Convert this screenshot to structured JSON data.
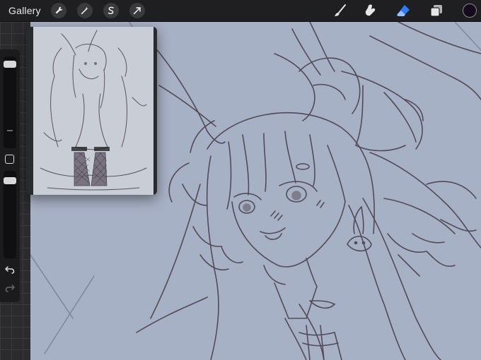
{
  "toolbar": {
    "gallery_label": "Gallery",
    "left_tools": [
      "actions-wrench",
      "adjustments-magic-wand",
      "selection-s",
      "transform-arrow"
    ],
    "right_tools": [
      "brush",
      "smudge",
      "eraser",
      "layers"
    ],
    "active_tool": "eraser",
    "color": "#16091c"
  },
  "sidebar": {
    "size_level": 0.05,
    "opacity_level": 0.08
  },
  "colors": {
    "canvas": "#a7b1c5",
    "accent": "#2f7bf5",
    "sketch_line": "#4a3f4c"
  }
}
